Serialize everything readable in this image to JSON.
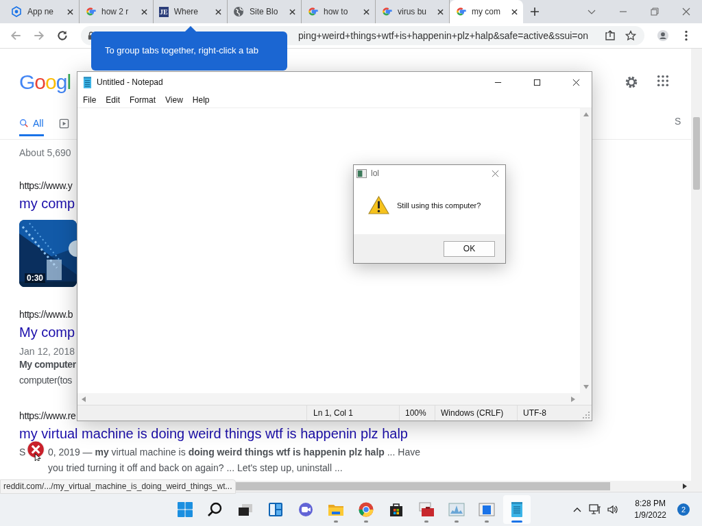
{
  "browser": {
    "tabs": [
      {
        "title": "App ne",
        "kind": "app",
        "selected": false
      },
      {
        "title": "how 2 r",
        "kind": "google",
        "selected": false
      },
      {
        "title": "Where",
        "kind": "letters",
        "icon_text": "JE",
        "selected": false
      },
      {
        "title": "Site Blo",
        "kind": "globe",
        "selected": false
      },
      {
        "title": "how to",
        "kind": "google",
        "selected": false
      },
      {
        "title": "virus bu",
        "kind": "google",
        "selected": false
      },
      {
        "title": "my com",
        "kind": "google",
        "selected": true
      }
    ],
    "address": "ping+weird+things+wtf+is+happenin+plz+halp&safe=active&ssui=on",
    "tooltip": "To group tabs together, right-click a tab",
    "status_url": "reddit.com/.../my_virtual_machine_is_doing_weird_things_wt..."
  },
  "search_page": {
    "logo": "Googl",
    "tabs": [
      {
        "label": "All",
        "selected": true
      }
    ],
    "right_tab": "S",
    "result_count": "About 5,690",
    "results": [
      {
        "kind": "video",
        "url": "https://www.y",
        "title": "my comp",
        "duration": "0:30"
      },
      {
        "kind": "text",
        "url": "https://www.b",
        "title": "My comp",
        "date": "Jan 12, 2018",
        "snippet_lines": [
          "**My computer**",
          "computer(tos"
        ]
      },
      {
        "kind": "covered",
        "url": "https://www.re",
        "title": "my virtual machine is doing weird things wtf is happenin plz halp",
        "date_start": "S",
        "snippet": "0, 2019 — **my** virtual machine is **doing weird things wtf is happenin plz halp** ... Have you tried turning it off and back on again? ... Let's step up, uninstall ..."
      }
    ]
  },
  "notepad": {
    "title": "Untitled - Notepad",
    "menu": [
      "File",
      "Edit",
      "Format",
      "View",
      "Help"
    ],
    "status": [
      "Ln 1, Col 1",
      "100%",
      "Windows (CRLF)",
      "UTF-8"
    ]
  },
  "dialog": {
    "title": "lol",
    "message": "Still using this computer?",
    "button": "OK"
  },
  "taskbar": {
    "apps": [
      {
        "kind": "start",
        "running": false,
        "selected": false
      },
      {
        "kind": "search",
        "running": false,
        "selected": false
      },
      {
        "kind": "taskview",
        "running": false,
        "selected": false
      },
      {
        "kind": "widgets",
        "running": false,
        "selected": false
      },
      {
        "kind": "chat",
        "running": false,
        "selected": false
      },
      {
        "kind": "folder",
        "running": true,
        "selected": false
      },
      {
        "kind": "chrome",
        "running": true,
        "selected": false
      },
      {
        "kind": "store",
        "running": false,
        "selected": false
      },
      {
        "kind": "toolbox",
        "running": true,
        "selected": false
      },
      {
        "kind": "monitor",
        "running": true,
        "selected": false
      },
      {
        "kind": "window",
        "running": true,
        "selected": false
      },
      {
        "kind": "notepad",
        "running": true,
        "selected": true
      }
    ],
    "time": "8:28 PM",
    "date": "1/9/2022",
    "notifications": "2"
  }
}
